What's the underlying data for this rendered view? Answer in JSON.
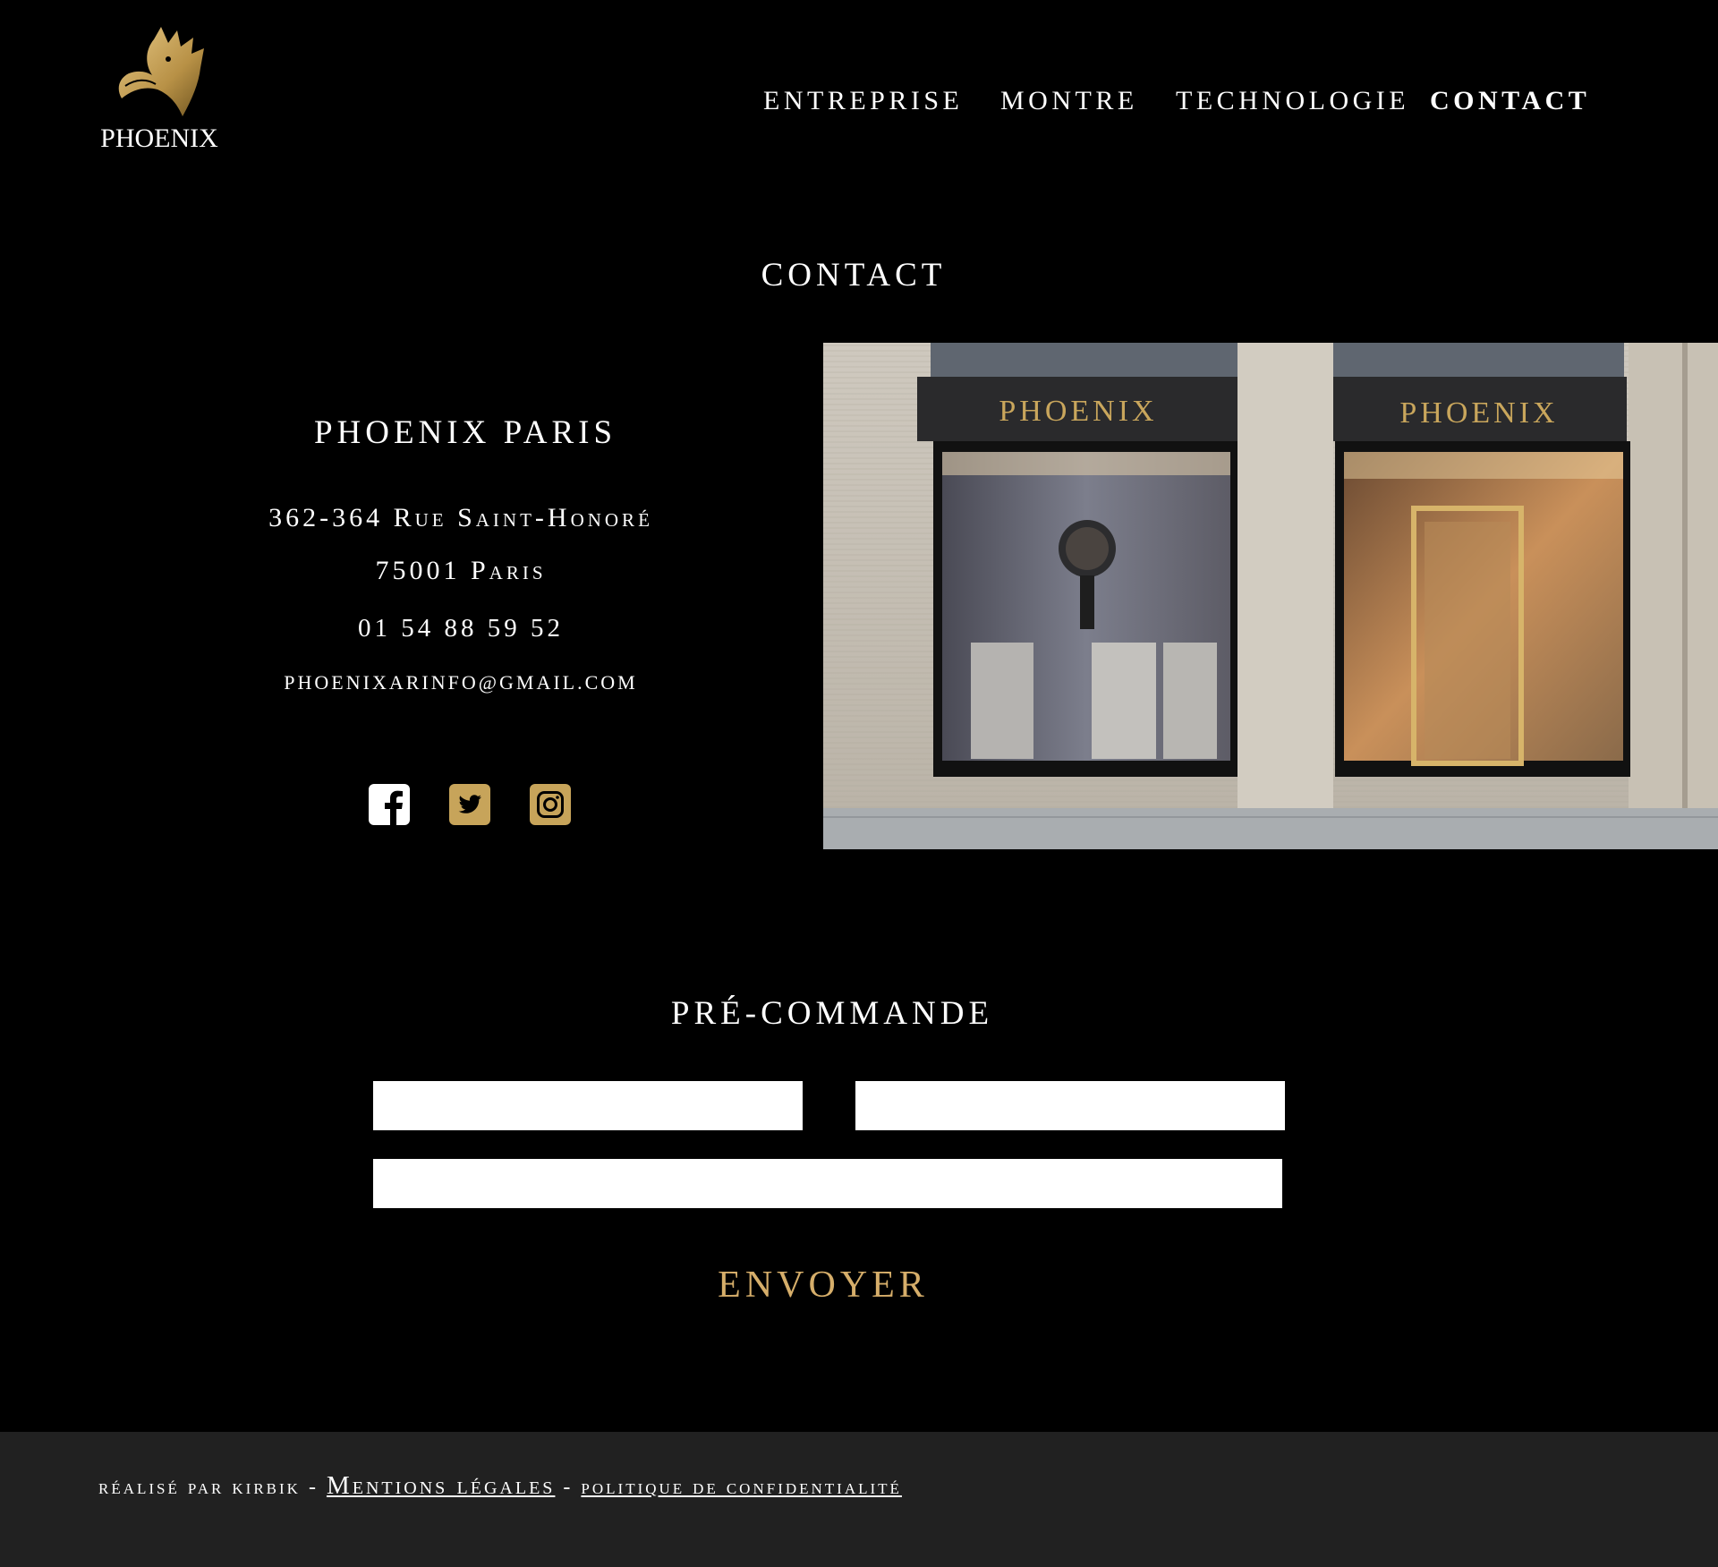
{
  "brand": {
    "name": "PHOENIX",
    "gold": "#c7a45a"
  },
  "nav": {
    "items": [
      {
        "label": "ENTREPRISE"
      },
      {
        "label": "MONTRE"
      },
      {
        "label": "TECHNOLOGIE"
      },
      {
        "label": "CONTACT",
        "active": true
      }
    ]
  },
  "contact": {
    "title": "CONTACT",
    "store_name": "PHOENIX PARIS",
    "address_line1": "362-364 Rue Saint-Honoré",
    "address_line2": "75001 Paris",
    "phone": "01 54 88 59 52",
    "email": "phoenixarinfo@gmail.com",
    "socials": [
      {
        "icon": "facebook-icon",
        "color": "#ffffff"
      },
      {
        "icon": "twitter-icon",
        "color": "#c7a45a"
      },
      {
        "icon": "instagram-icon",
        "color": "#c7a45a"
      }
    ],
    "storefront": {
      "sign_text": "PHOENIX"
    }
  },
  "preorder": {
    "title": "PRÉ-COMMANDE",
    "fields": [
      {
        "value": "",
        "placeholder": ""
      },
      {
        "value": "",
        "placeholder": ""
      },
      {
        "value": "",
        "placeholder": ""
      }
    ],
    "submit_label": "ENVOYER",
    "submit_color": "#d6ae6a"
  },
  "footer": {
    "credit": "réalisé par kirbik",
    "separator": "-",
    "mentions": "Mentions légales",
    "privacy": "politique de confidentialité",
    "background": "#212121"
  }
}
